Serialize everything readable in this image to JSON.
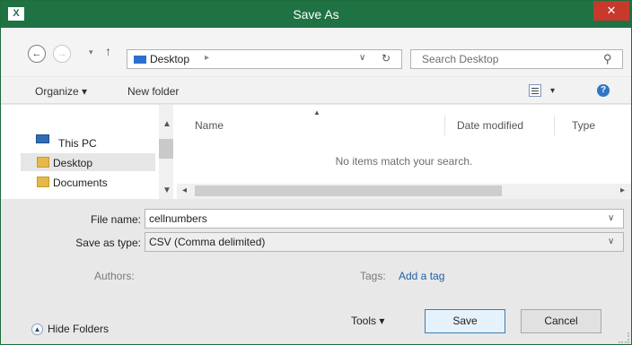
{
  "window": {
    "title": "Save As",
    "app_icon_label": "X",
    "close_label": "✕"
  },
  "nav": {
    "back_label": "←",
    "forward_label": "→",
    "recent_label": "▾",
    "up_label": "↑",
    "address": "Desktop",
    "address_separator": "▸",
    "address_dropdown": "∨",
    "refresh_label": "↻",
    "search_placeholder": "Search Desktop"
  },
  "toolbar": {
    "organize_label": "Organize ▾",
    "new_folder_label": "New folder",
    "view_dropdown": "▾",
    "help_label": "?"
  },
  "nav_pane": {
    "items": [
      {
        "label": "This PC",
        "icon": "computer-icon"
      },
      {
        "label": "Desktop",
        "icon": "folder-icon",
        "selected": true
      },
      {
        "label": "Documents",
        "icon": "folder-icon"
      }
    ],
    "scroll_up": "▲",
    "scroll_down": "▼"
  },
  "file_list": {
    "columns": [
      "Name",
      "Date modified",
      "Type"
    ],
    "sort_indicator": "▲",
    "empty_message": "No items match your search.",
    "scroll_left": "◂",
    "scroll_right": "▸"
  },
  "form": {
    "file_name_label": "File name:",
    "file_name_value": "cellnumbers",
    "save_type_label": "Save as type:",
    "save_type_value": "CSV (Comma delimited)",
    "dropdown_glyph": "∨",
    "authors_label": "Authors:",
    "tags_label": "Tags:",
    "add_tag_label": "Add a tag"
  },
  "footer": {
    "hide_folders_label": "Hide Folders",
    "hide_folders_icon": "▲",
    "tools_label": "Tools  ▾",
    "save_label": "Save",
    "cancel_label": "Cancel"
  },
  "colors": {
    "titlebar": "#1f7244",
    "close": "#c7392b",
    "link": "#1f5fa6"
  }
}
